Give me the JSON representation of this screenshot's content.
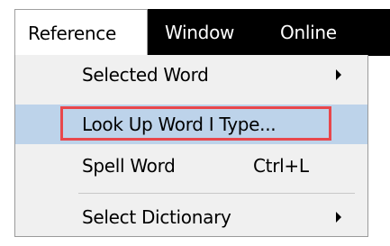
{
  "menubar": {
    "items": [
      {
        "label": "Reference",
        "active": true
      },
      {
        "label": "Window",
        "active": false
      },
      {
        "label": "Online",
        "active": false
      }
    ]
  },
  "menu": {
    "items": [
      {
        "label": "Selected Word",
        "shortcut": "",
        "submenu": true,
        "highlighted": false
      },
      {
        "label": "Look Up Word I Type...",
        "shortcut": "",
        "submenu": false,
        "highlighted": true
      },
      {
        "label": "Spell Word",
        "shortcut": "Ctrl+L",
        "submenu": false,
        "highlighted": false
      },
      {
        "label": "Select Dictionary",
        "shortcut": "",
        "submenu": true,
        "highlighted": false
      }
    ]
  },
  "colors": {
    "menubar_bg": "#000000",
    "menu_bg": "#f0f0f0",
    "highlight": "#bdd3ea",
    "callout": "#e8474c"
  },
  "icons": {
    "submenu": "submenu-arrow-icon"
  }
}
